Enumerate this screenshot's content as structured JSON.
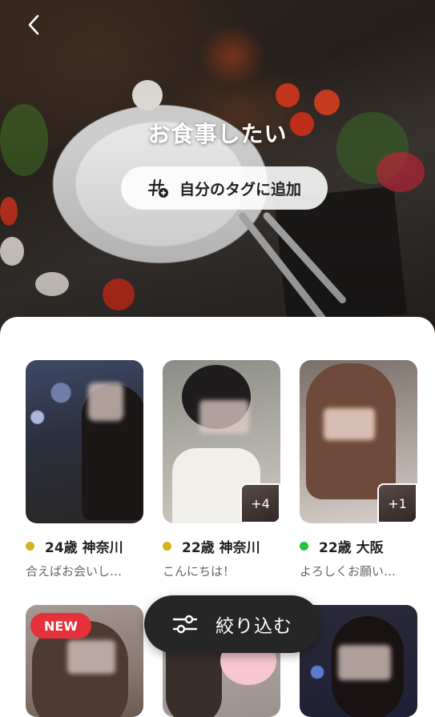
{
  "header": {
    "back_icon": "chevron-left-icon",
    "title": "お食事したい",
    "add_tag_label": "自分のタグに追加",
    "add_tag_icon": "hashtag-plus-icon"
  },
  "users": [
    {
      "age_location": "24歳 神奈川",
      "message": "合えばお会いし…",
      "status_color": "#d6b31c",
      "extra_photos": ""
    },
    {
      "age_location": "22歳 神奈川",
      "message": "こんにちは！",
      "status_color": "#d6b31c",
      "extra_photos": "+4"
    },
    {
      "age_location": "22歳 大阪",
      "message": "よろしくお願い…",
      "status_color": "#22c43a",
      "extra_photos": "+1"
    }
  ],
  "second_row": [
    {
      "badge": "NEW"
    },
    {
      "badge": ""
    },
    {
      "badge": ""
    }
  ],
  "filter": {
    "label": "絞り込む",
    "icon": "sliders-icon"
  },
  "colors": {
    "accent_new": "#e5323a",
    "filter_bg": "#262626"
  }
}
